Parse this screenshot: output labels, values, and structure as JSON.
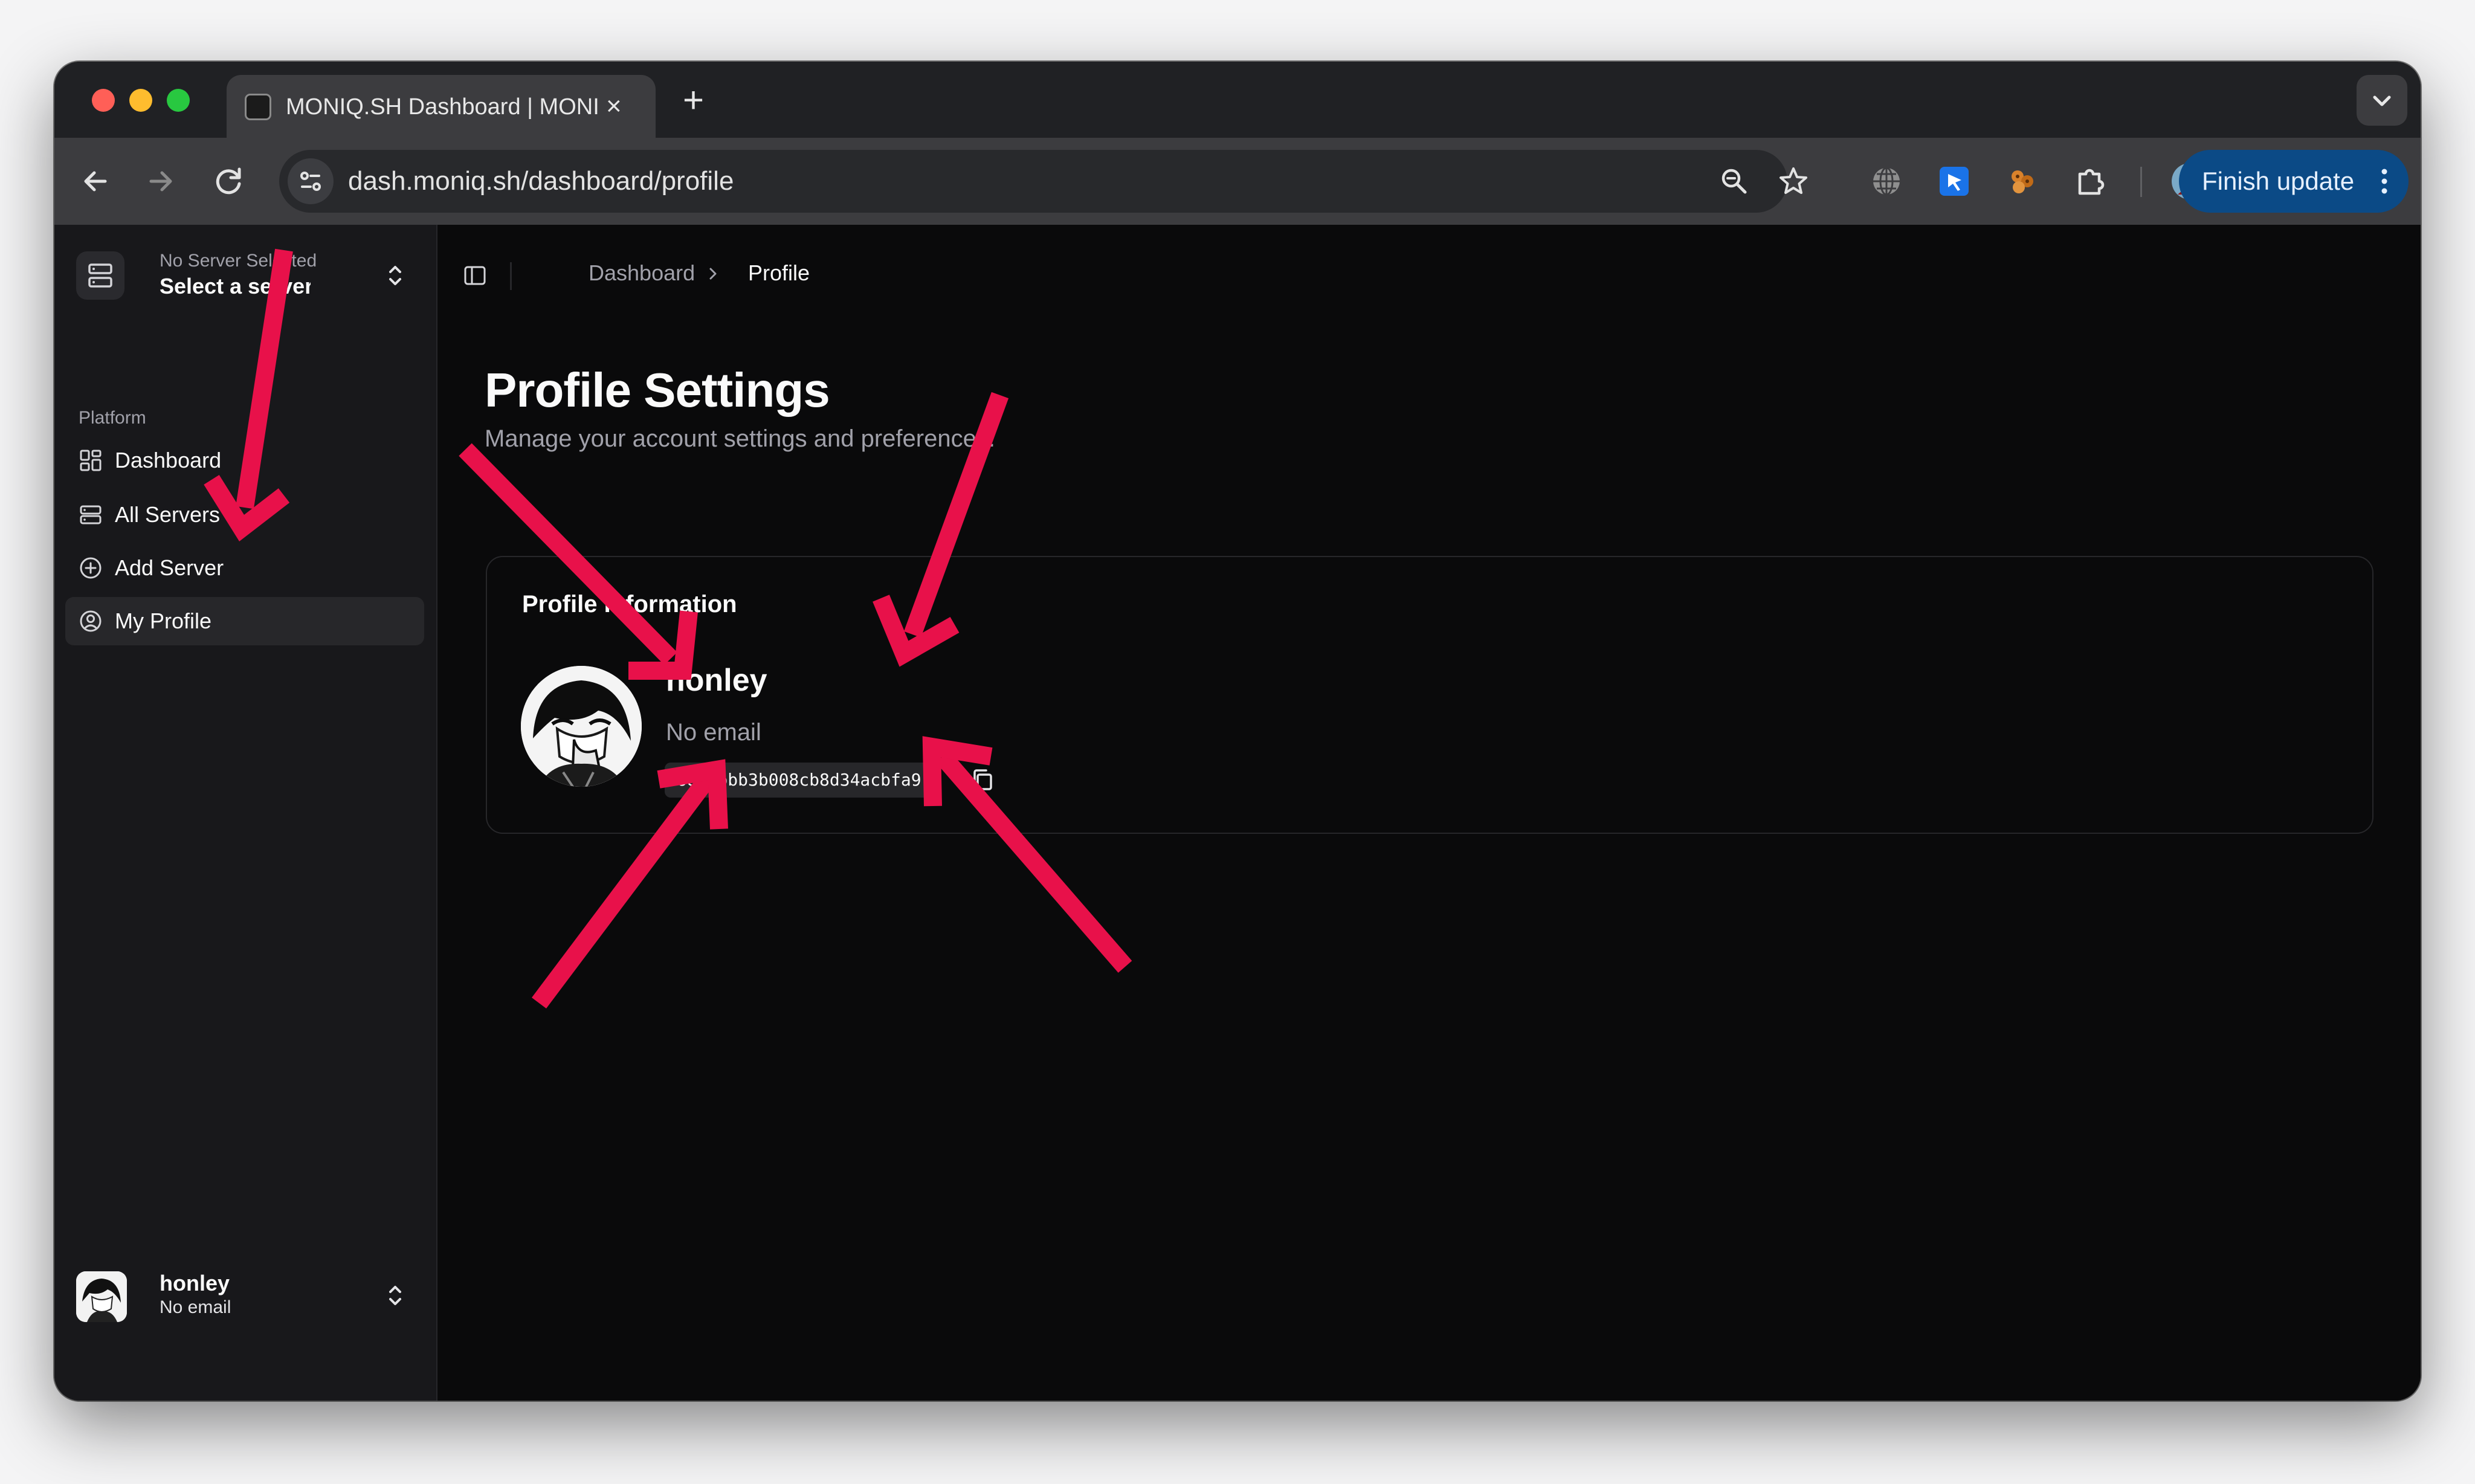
{
  "browser": {
    "tab_title": "MONIQ.SH Dashboard | MONIQ.SH",
    "url": "dash.moniq.sh/dashboard/profile",
    "finish_update_label": "Finish update"
  },
  "sidebar": {
    "server_switcher": {
      "subtitle": "No Server Selected",
      "title": "Select a server"
    },
    "group_label": "Platform",
    "items": [
      {
        "label": "Dashboard",
        "icon": "dashboard-grid-icon"
      },
      {
        "label": "All Servers",
        "icon": "server-stack-icon"
      },
      {
        "label": "Add Server",
        "icon": "plus-circle-icon"
      },
      {
        "label": "My Profile",
        "icon": "user-circle-icon",
        "active": true
      }
    ],
    "user": {
      "name": "honley",
      "email": "No email"
    }
  },
  "breadcrumb": {
    "parent": "Dashboard",
    "current": "Profile"
  },
  "main": {
    "title": "Profile Settings",
    "subtitle": "Manage your account settings and preferences.",
    "card": {
      "title": "Profile Information",
      "name": "honley",
      "email": "No email",
      "user_id": "6893bbb3b008cb8d34acbfa9"
    }
  },
  "colors": {
    "annotation_arrow": "#e8114a",
    "finish_update_button": "#0b4a86",
    "sidebar_bg": "#18181b",
    "main_bg": "#0a0a0b"
  }
}
